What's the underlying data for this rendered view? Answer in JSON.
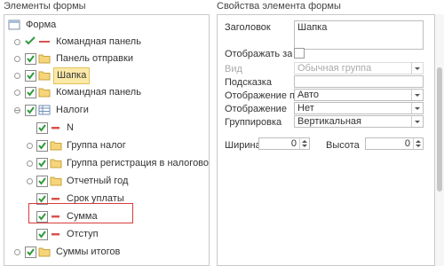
{
  "left_panel": {
    "title": "Элементы формы"
  },
  "right_panel": {
    "title": "Свойства элемента формы"
  },
  "tree": {
    "root": "Форма",
    "items": [
      {
        "label": "Командная панель"
      },
      {
        "label": "Панель отправки"
      },
      {
        "label": "Шапка"
      },
      {
        "label": "Командная панель"
      },
      {
        "label": "Налоги"
      },
      {
        "label": "N"
      },
      {
        "label": "Группа налог"
      },
      {
        "label": "Группа регистрация в налоговом органе"
      },
      {
        "label": "Отчетный год"
      },
      {
        "label": "Срок уплаты"
      },
      {
        "label": "Сумма"
      },
      {
        "label": "Отступ"
      },
      {
        "label": "Суммы итогов"
      }
    ]
  },
  "props": {
    "header_label": "Заголовок",
    "header_value": "Шапка",
    "show_header_label": "Отображать заголовок",
    "view_label": "Вид",
    "view_value": "Обычная группа",
    "hint_label": "Подсказка",
    "hint_value": "",
    "show_mode_label": "Отображение подсказки",
    "show_mode_value": "Авто",
    "display_label": "Отображение",
    "display_value": "Нет",
    "grouping_label": "Группировка",
    "grouping_value": "Вертикальная",
    "width_label": "Ширина",
    "width_value": "0",
    "height_label": "Высота",
    "height_value": "0"
  }
}
